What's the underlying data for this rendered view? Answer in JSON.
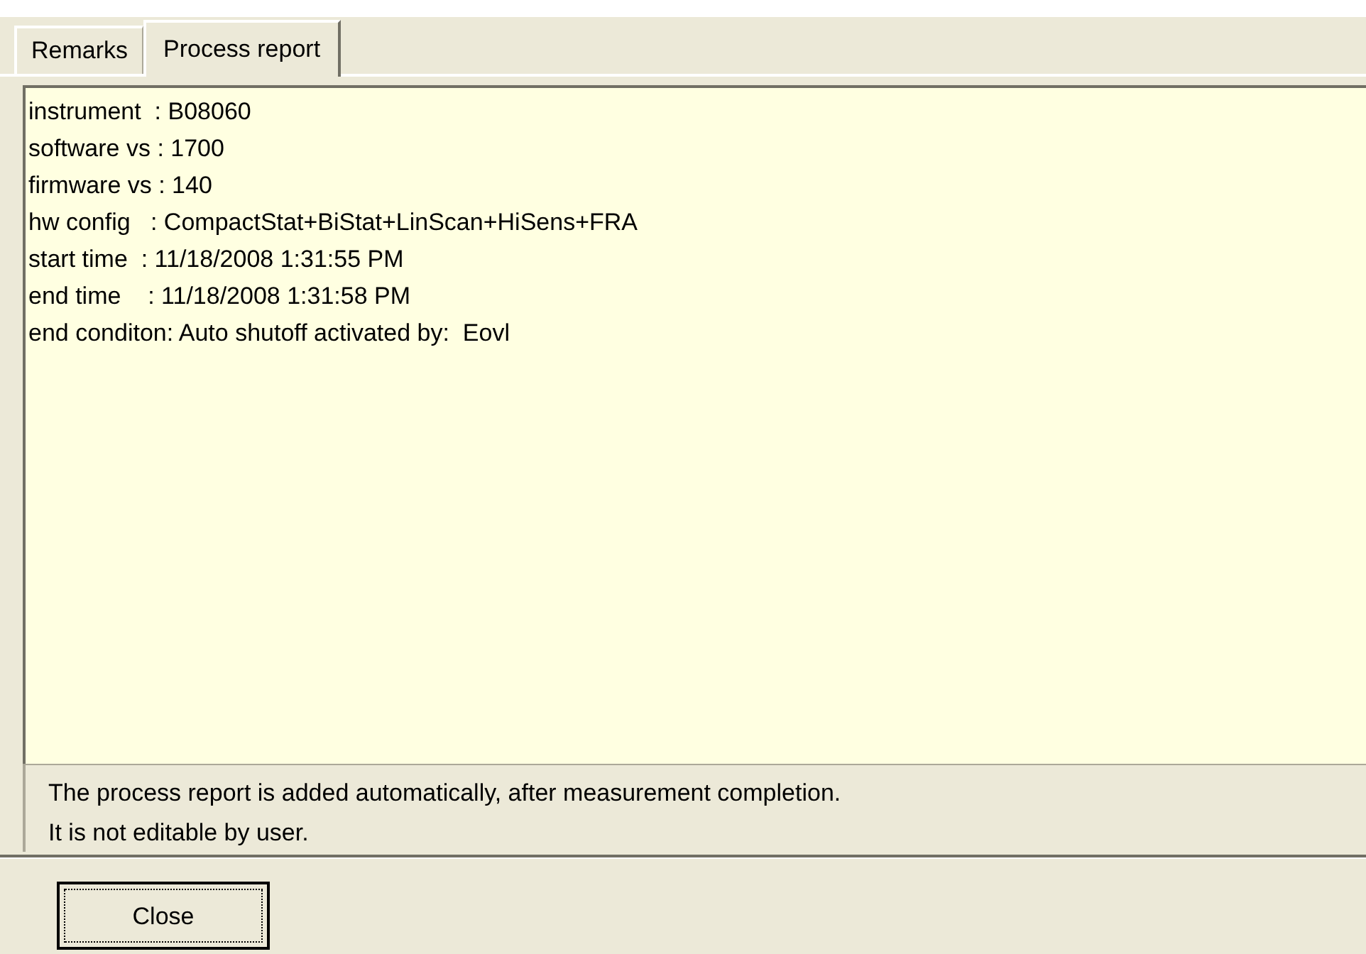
{
  "tabs": [
    {
      "label": "Remarks",
      "selected": false
    },
    {
      "label": "Process report",
      "selected": true
    }
  ],
  "report_lines": [
    "instrument  : B08060",
    "software vs : 1700",
    "firmware vs : 140",
    "hw config   : CompactStat+BiStat+LinScan+HiSens+FRA",
    "start time  : 11/18/2008 1:31:55 PM",
    "end time    : 11/18/2008 1:31:58 PM",
    "end conditon: Auto shutoff activated by:  Eovl"
  ],
  "info_lines": [
    "The process report is added automatically, after measurement completion.",
    "It is not editable by user."
  ],
  "buttons": [
    "Close"
  ]
}
